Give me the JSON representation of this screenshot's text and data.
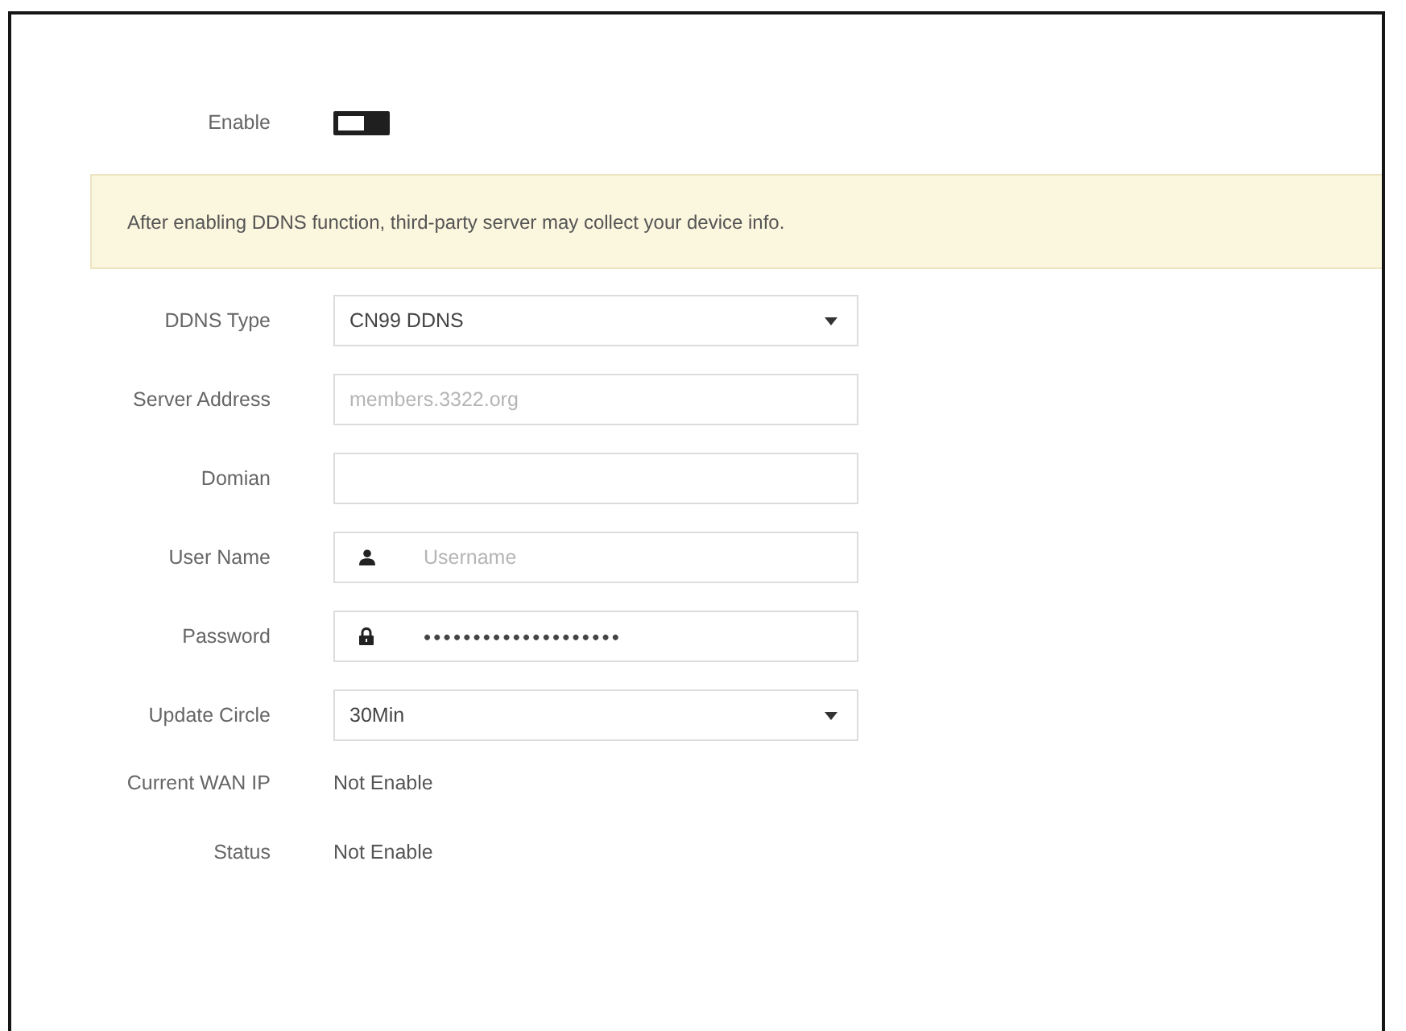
{
  "enable": {
    "label": "Enable",
    "on": false
  },
  "notice": "After enabling DDNS function, third-party server may collect your device info.",
  "fields": [
    {
      "kind": "select",
      "label": "DDNS Type",
      "value": "CN99 DDNS"
    },
    {
      "kind": "text",
      "label": "Server Address",
      "placeholder": "members.3322.org"
    },
    {
      "kind": "text",
      "label": "Domian"
    },
    {
      "kind": "user",
      "label": "User Name",
      "placeholder": "Username"
    },
    {
      "kind": "password",
      "label": "Password",
      "value": "••••••••••••••••••••"
    },
    {
      "kind": "select",
      "label": "Update Circle",
      "value": "30Min"
    }
  ],
  "info": [
    {
      "label": "Current WAN IP",
      "value": "Not Enable"
    },
    {
      "label": "Status",
      "value": "Not Enable"
    }
  ]
}
